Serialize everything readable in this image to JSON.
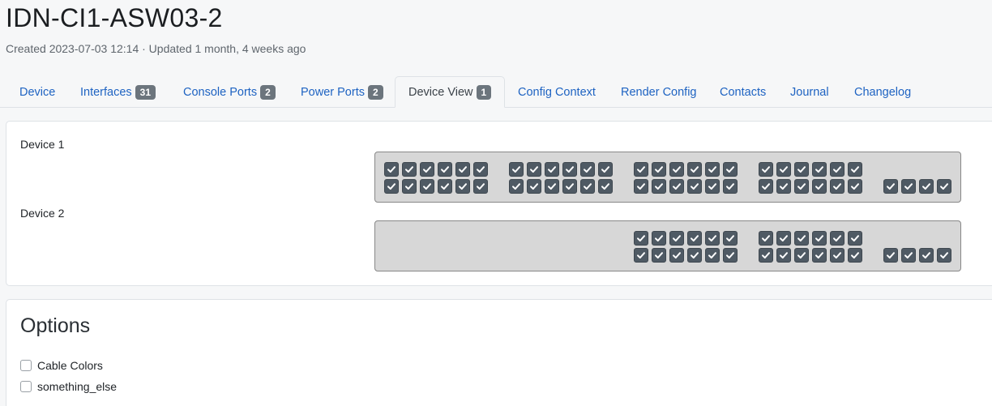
{
  "header": {
    "title": "IDN-CI1-ASW03-2",
    "meta": "Created 2023-07-03 12:14 · Updated 1 month, 4 weeks ago"
  },
  "tabs": [
    {
      "label": "Device"
    },
    {
      "label": "Interfaces",
      "badge": "31"
    },
    {
      "label": "Console Ports",
      "badge": "2"
    },
    {
      "label": "Power Ports",
      "badge": "2"
    },
    {
      "label": "Device View",
      "badge": "1",
      "active": true
    },
    {
      "label": "Config Context"
    },
    {
      "label": "Render Config"
    },
    {
      "label": "Contacts"
    },
    {
      "label": "Journal"
    },
    {
      "label": "Changelog"
    }
  ],
  "device_view": {
    "device1_label": "Device 1",
    "device2_label": "Device 2",
    "device1_port_count": 52,
    "device2_port_count": 28,
    "port_icon": "check-icon",
    "colors": {
      "port": "#4f5a64",
      "chassis": "#d7d7d7",
      "link": "#1e63c2"
    }
  },
  "options": {
    "title": "Options",
    "items": [
      {
        "label": "Cable Colors",
        "checked": false
      },
      {
        "label": "something_else",
        "checked": false
      }
    ]
  }
}
